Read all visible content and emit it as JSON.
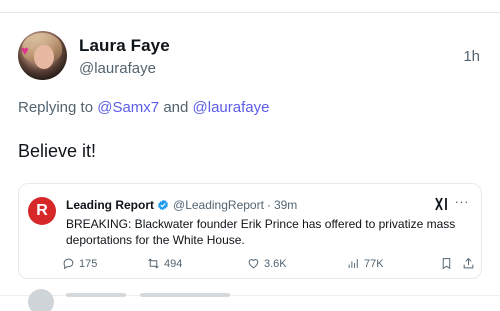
{
  "post": {
    "display_name": "Laura Faye",
    "handle": "@laurafaye",
    "timestamp": "1h",
    "replying_prefix": "Replying to",
    "reply_mention_1": "@Samx7",
    "reply_conjunction": "and",
    "reply_mention_2": "@laurafaye",
    "text": "Believe it!"
  },
  "quote": {
    "account_name": "Leading Report",
    "account_handle": "@LeadingReport",
    "separator": "·",
    "age": "39m",
    "body": "BREAKING: Blackwater founder Erik Prince has offered to privatize mass deportations for the White House.",
    "logo_letter": "R",
    "actions": {
      "replies": "175",
      "reposts": "494",
      "likes": "3.6K",
      "views": "77K"
    }
  },
  "icons": {
    "verified": "verified-badge-icon",
    "grok": "grok-icon",
    "more": "more-icon",
    "reply": "reply-icon",
    "repost": "repost-icon",
    "like": "like-icon",
    "views": "views-icon",
    "bookmark": "bookmark-icon",
    "share": "share-icon"
  },
  "colors": {
    "mention": "#5b5ce8",
    "verified": "#1d9bf0",
    "logo_red": "#d62828",
    "secondary_text": "#536471"
  }
}
